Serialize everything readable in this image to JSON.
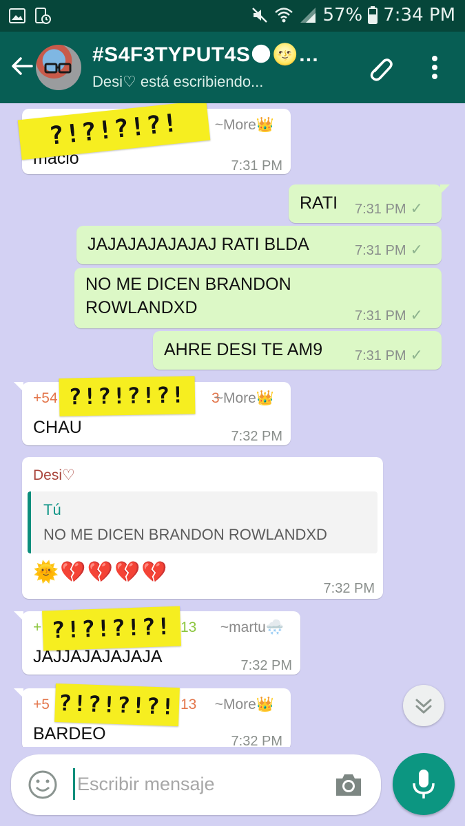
{
  "status_bar": {
    "battery_pct": "57%",
    "time": "7:34 PM",
    "icons": [
      "gallery-icon",
      "screen-alert-icon",
      "mute-icon",
      "wifi-icon",
      "signal-icon",
      "battery-icon"
    ]
  },
  "header": {
    "title": "#S4F3TYPUT4S🌑🌝…",
    "subtitle": "Desi♡ está escribiendo..."
  },
  "messages": [
    {
      "type": "incoming",
      "sticker": "?!?!?!?!",
      "nick": "~More👑",
      "text": "macio",
      "time": "7:31 PM"
    },
    {
      "type": "outgoing",
      "text": "RATI",
      "time": "7:31 PM"
    },
    {
      "type": "outgoing",
      "text": "JAJAJAJAJAJAJ RATI BLDA",
      "time": "7:31 PM"
    },
    {
      "type": "outgoing",
      "line1": "NO ME DICEN BRANDON",
      "line2": "ROWLANDXD",
      "time": "7:31 PM"
    },
    {
      "type": "outgoing",
      "text": "AHRE DESI TE AM9",
      "time": "7:31 PM"
    },
    {
      "type": "incoming",
      "sender_prefix": "+54",
      "sender_suffix": "3",
      "sticker": "?!?!?!?!",
      "nick": "~More👑",
      "text": "CHAU",
      "time": "7:32 PM"
    },
    {
      "type": "incoming",
      "sender": "Desi♡",
      "quote_author": "Tú",
      "quote_text": "NO ME DICEN BRANDON ROWLANDXD",
      "text": "🌞💔💔💔💔",
      "time": "7:32 PM"
    },
    {
      "type": "incoming",
      "sender_prefix": "+",
      "sender_suffix": "13",
      "sticker": "?!?!?!?!",
      "nick": "~martu🌨️",
      "text": "JAJJAJAJAJAJA",
      "time": "7:32 PM"
    },
    {
      "type": "incoming",
      "sender_prefix": "+5",
      "sender_suffix": "13",
      "sticker": "?!?!?!?!",
      "nick": "~More👑",
      "text": "BARDEO",
      "time": "7:32 PM"
    }
  ],
  "input": {
    "placeholder": "Escribir mensaje"
  },
  "colors": {
    "header": "#075e54",
    "status_bar": "#06463a",
    "chat_bg": "#d3d1f3",
    "outgoing_bubble": "#dcf8c6",
    "incoming_bubble": "#ffffff",
    "sticker": "#f6ee20",
    "mic_button": "#0c9681"
  }
}
